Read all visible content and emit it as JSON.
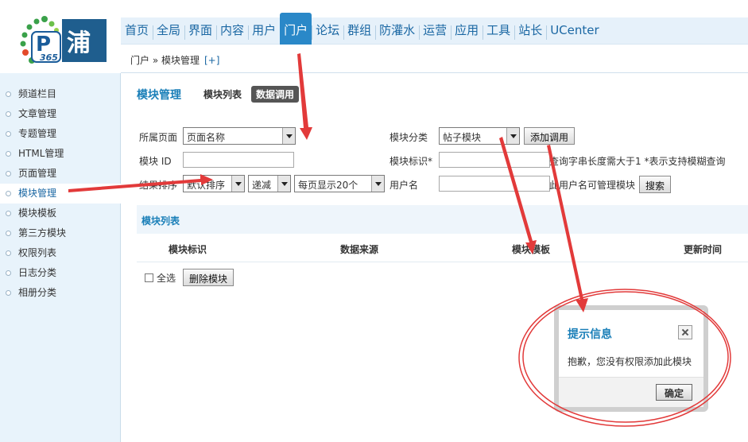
{
  "header": {
    "logo_text": "365 浦",
    "nav": [
      "首页",
      "全局",
      "界面",
      "内容",
      "用户",
      "门户",
      "论坛",
      "群组",
      "防灌水",
      "运营",
      "应用",
      "工具",
      "站长",
      "UCenter"
    ],
    "active_nav_index": 5
  },
  "breadcrumb": {
    "path": "门户 » 模块管理",
    "add": "[+]"
  },
  "sidebar": {
    "items": [
      "频道栏目",
      "文章管理",
      "专题管理",
      "HTML管理",
      "页面管理",
      "模块管理",
      "模块模板",
      "第三方模块",
      "权限列表",
      "日志分类",
      "相册分类"
    ],
    "active_index": 5
  },
  "main": {
    "title": "模块管理",
    "tabs": [
      "模块列表",
      "数据调用"
    ],
    "active_tab_index": 1
  },
  "form": {
    "page_label": "所属页面",
    "page_value": "页面名称",
    "id_label": "模块 ID",
    "id_value": "",
    "sort_label": "结果排序",
    "sort_value": "默认排序",
    "order_value": "递减",
    "per_page_value": "每页显示20个",
    "category_label": "模块分类",
    "category_value": "帖子模块",
    "add_call_button": "添加调用",
    "tag_label": "模块标识*",
    "tag_value": "",
    "tag_hint": "查询字串长度需大于1  *表示支持模糊查询",
    "username_label": "用户名",
    "username_value": "",
    "username_hint": "此用户名可管理模块",
    "search_button": "搜索"
  },
  "list": {
    "title": "模块列表",
    "columns": [
      "模块标识",
      "数据来源",
      "模块模板",
      "更新时间"
    ],
    "select_all_label": "全选",
    "delete_button": "删除模块"
  },
  "dialog": {
    "title": "提示信息",
    "message": "抱歉，您没有权限添加此模块",
    "ok_button": "确定"
  },
  "colors": {
    "accent": "#1a7fb8",
    "annotation": "#e23a3a"
  }
}
